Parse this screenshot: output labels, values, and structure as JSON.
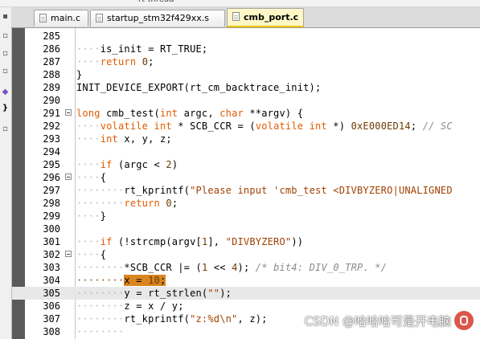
{
  "top_strip": {
    "fragment": "rt-thread"
  },
  "tabs": [
    {
      "label": "main.c",
      "active": false
    },
    {
      "label": "startup_stm32f429xx.s",
      "active": false
    },
    {
      "label": "cmb_port.c",
      "active": true
    }
  ],
  "editor": {
    "selected_line": 304,
    "current_line": 305,
    "lines": [
      {
        "num": "285",
        "indent": 0,
        "fold": false,
        "tokens": []
      },
      {
        "num": "286",
        "indent": 1,
        "fold": false,
        "tokens": [
          [
            "t",
            "is_init = RT_TRUE;"
          ]
        ]
      },
      {
        "num": "287",
        "indent": 1,
        "fold": false,
        "tokens": [
          [
            "kw",
            "return"
          ],
          [
            "t",
            " "
          ],
          [
            "num",
            "0"
          ],
          [
            "t",
            ";"
          ]
        ]
      },
      {
        "num": "288",
        "indent": 0,
        "fold": false,
        "tokens": [
          [
            "t",
            "}"
          ]
        ]
      },
      {
        "num": "289",
        "indent": 0,
        "fold": false,
        "tokens": [
          [
            "t",
            "INIT_DEVICE_EXPORT(rt_cm_backtrace_init);"
          ]
        ]
      },
      {
        "num": "290",
        "indent": 0,
        "fold": false,
        "tokens": []
      },
      {
        "num": "291",
        "indent": 0,
        "fold": true,
        "tokens": [
          [
            "kw",
            "long"
          ],
          [
            "t",
            " cmb_test("
          ],
          [
            "kw",
            "int"
          ],
          [
            "t",
            " argc, "
          ],
          [
            "kw",
            "char"
          ],
          [
            "t",
            " **argv) {"
          ]
        ]
      },
      {
        "num": "292",
        "indent": 1,
        "fold": false,
        "tokens": [
          [
            "kw",
            "volatile int"
          ],
          [
            "t",
            " * SCB_CCR = ("
          ],
          [
            "kw",
            "volatile int"
          ],
          [
            "t",
            " *) "
          ],
          [
            "num",
            "0xE000ED14"
          ],
          [
            "t",
            "; "
          ],
          [
            "cmt",
            "// SC"
          ]
        ]
      },
      {
        "num": "293",
        "indent": 1,
        "fold": false,
        "tokens": [
          [
            "kw",
            "int"
          ],
          [
            "t",
            " x, y, z;"
          ]
        ]
      },
      {
        "num": "294",
        "indent": 0,
        "fold": false,
        "tokens": []
      },
      {
        "num": "295",
        "indent": 1,
        "fold": false,
        "tokens": [
          [
            "kw",
            "if"
          ],
          [
            "t",
            " (argc < "
          ],
          [
            "num",
            "2"
          ],
          [
            "t",
            ")"
          ]
        ]
      },
      {
        "num": "296",
        "indent": 1,
        "fold": true,
        "tokens": [
          [
            "t",
            "{"
          ]
        ]
      },
      {
        "num": "297",
        "indent": 2,
        "fold": false,
        "tokens": [
          [
            "t",
            "rt_kprintf("
          ],
          [
            "str",
            "\"Please input 'cmb_test <DIVBYZERO|UNALIGNED"
          ]
        ]
      },
      {
        "num": "298",
        "indent": 2,
        "fold": false,
        "tokens": [
          [
            "kw",
            "return"
          ],
          [
            "t",
            " "
          ],
          [
            "num",
            "0"
          ],
          [
            "t",
            ";"
          ]
        ]
      },
      {
        "num": "299",
        "indent": 1,
        "fold": false,
        "tokens": [
          [
            "t",
            "}"
          ]
        ]
      },
      {
        "num": "300",
        "indent": 0,
        "fold": false,
        "tokens": []
      },
      {
        "num": "301",
        "indent": 1,
        "fold": false,
        "tokens": [
          [
            "kw",
            "if"
          ],
          [
            "t",
            " (!strcmp(argv["
          ],
          [
            "num",
            "1"
          ],
          [
            "t",
            "], "
          ],
          [
            "str",
            "\"DIVBYZERO\""
          ],
          [
            "t",
            "))"
          ]
        ]
      },
      {
        "num": "302",
        "indent": 1,
        "fold": true,
        "tokens": [
          [
            "t",
            "{"
          ]
        ]
      },
      {
        "num": "303",
        "indent": 2,
        "fold": false,
        "tokens": [
          [
            "t",
            "*SCB_CCR |= ("
          ],
          [
            "num",
            "1"
          ],
          [
            "t",
            " << "
          ],
          [
            "num",
            "4"
          ],
          [
            "t",
            "); "
          ],
          [
            "cmt",
            "/* bit4: DIV_0_TRP. */"
          ]
        ]
      },
      {
        "num": "304",
        "indent": 2,
        "fold": false,
        "tokens": [
          [
            "t",
            "x = "
          ],
          [
            "num",
            "10"
          ],
          [
            "t",
            ";"
          ]
        ]
      },
      {
        "num": "305",
        "indent": 2,
        "fold": false,
        "tokens": [
          [
            "t",
            "y = rt_strlen("
          ],
          [
            "str",
            "\"\""
          ],
          [
            "t",
            ");"
          ]
        ]
      },
      {
        "num": "306",
        "indent": 2,
        "fold": false,
        "tokens": [
          [
            "t",
            "z = x / y;"
          ]
        ]
      },
      {
        "num": "307",
        "indent": 2,
        "fold": false,
        "tokens": [
          [
            "t",
            "rt_kprintf("
          ],
          [
            "str",
            "\"z:%d\\n\""
          ],
          [
            "t",
            ", z);"
          ]
        ]
      },
      {
        "num": "308",
        "indent": 2,
        "fold": false,
        "tokens": []
      }
    ]
  },
  "watermark": {
    "text": "CSDN @哈哈哈可是开电脑"
  }
}
